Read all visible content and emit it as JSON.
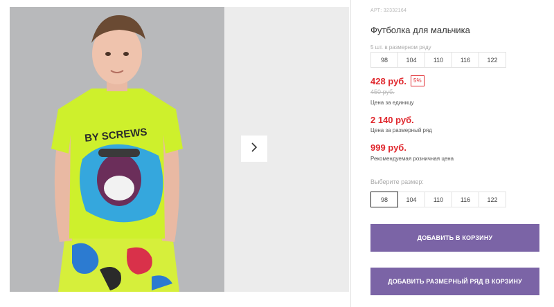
{
  "product": {
    "article": "АРТ: 32332164",
    "title": "Футболка для мальчика",
    "size_note": "5 шт. в размерном ряду",
    "size_row": [
      "98",
      "104",
      "110",
      "116",
      "122"
    ],
    "price": "428 руб.",
    "discount_badge": "5%",
    "old_price": "450 руб.",
    "price_caption": "Цена за единицу",
    "row_price": "2 140 руб.",
    "row_price_caption": "Цена за размерный ряд",
    "retail_price": "999 руб.",
    "retail_caption": "Рекомендуемая розничная цена",
    "choose_label": "Выберите размер:",
    "size_options": [
      "98",
      "104",
      "110",
      "116",
      "122"
    ],
    "selected_size": "98",
    "add_to_cart": "Добавить в корзину",
    "add_row_to_cart": "Добавить размерный ряд в корзину"
  },
  "colors": {
    "price_red": "#e0282e",
    "button_purple": "#7b64a6"
  },
  "icons": {
    "gallery_next": "chevron-right-icon"
  }
}
